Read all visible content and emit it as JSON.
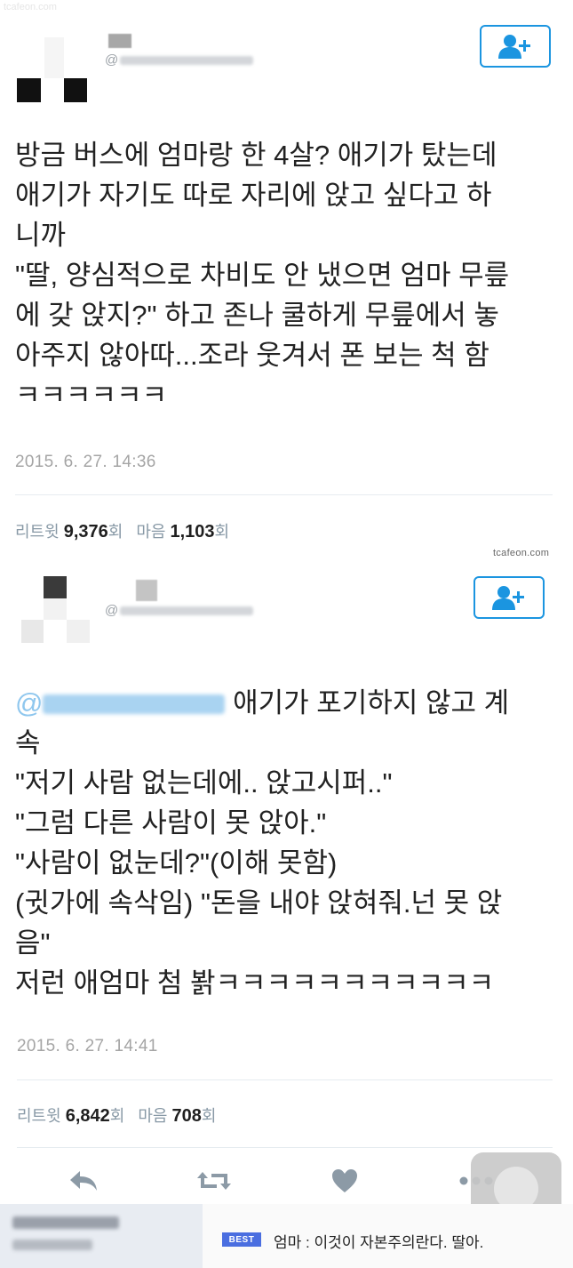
{
  "watermark_top": "tcafeon.com",
  "watermark_mid": "tcafeon.com",
  "tweet1": {
    "handle_prefix": "@",
    "text": "방금 버스에 엄마랑 한 4살? 애기가 탔는데\n애기가 자기도 따로 자리에 앉고 싶다고 하\n니까\n\"딸, 양심적으로 차비도 안 냈으면 엄마 무릎\n에 갖 앉지?\" 하고 존나 쿨하게 무릎에서 놓\n아주지 않아따...조라 웃겨서 폰 보는 척 함\nㅋㅋㅋㅋㅋㅋ",
    "timestamp": "2015. 6. 27. 14:36",
    "retweet_label": "리트윗",
    "retweet_count": "9,376",
    "like_label": "마음",
    "like_count": "1,103",
    "count_suffix": "회"
  },
  "tweet2": {
    "handle_prefix": "@",
    "mention_prefix": "@",
    "text_line1": " 애기가 포기하지 않고 계",
    "text_rest": "속\n\"저기 사람 없는데에.. 앉고시퍼..\"\n\"그럼 다른 사람이 못 앉아.\"\n\"사람이 없눈데?\"(이해 못함)\n(귓가에 속삭임) \"돈을 내야 앉혀줘.넌 못 앉\n음\"\n저런 애엄마 첨 봙ㅋㅋㅋㅋㅋㅋㅋㅋㅋㅋㅋ",
    "timestamp": "2015. 6. 27. 14:41",
    "retweet_label": "리트윗",
    "retweet_count": "6,842",
    "like_label": "마음",
    "like_count": "708",
    "count_suffix": "회"
  },
  "bottom_bar": {
    "badge": "BEST",
    "comment": "엄마 : 이것이 자본주의란다. 딸아."
  },
  "colors": {
    "accent": "#1b95e0",
    "timestamp": "#a5a5a5",
    "badge": "#4a6ee0"
  },
  "icons": [
    "follow-user-icon",
    "reply-icon",
    "retweet-icon",
    "heart-icon",
    "more-icon"
  ]
}
